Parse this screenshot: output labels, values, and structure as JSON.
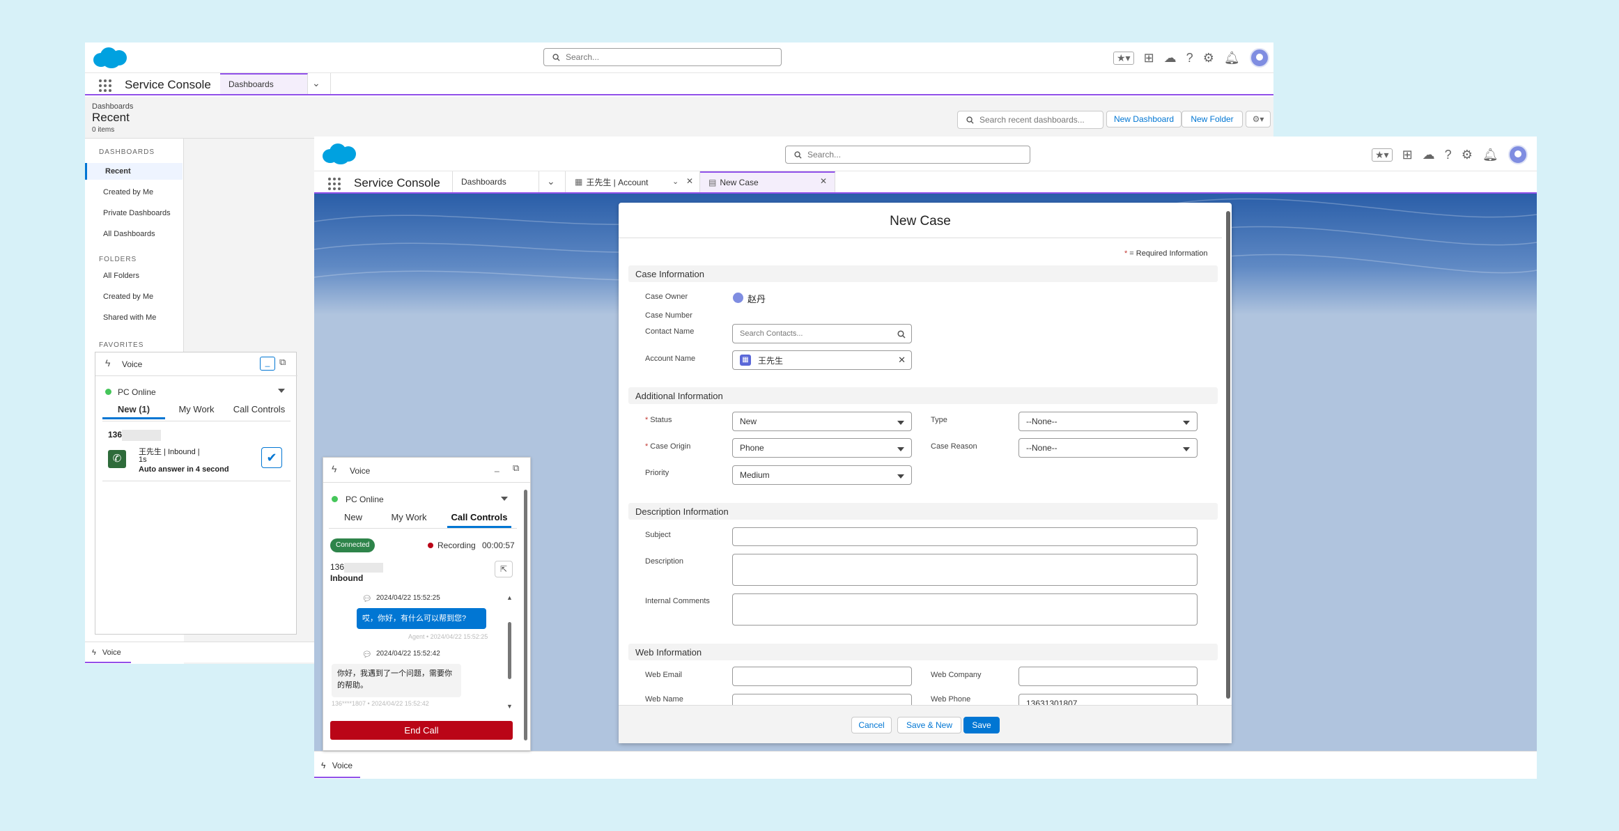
{
  "back": {
    "search_placeholder": "Search...",
    "app_name": "Service Console",
    "tab_dashboards": "Dashboards",
    "breadcrumb": "Dashboards",
    "title": "Recent",
    "count": "0 items",
    "search_dash_placeholder": "Search recent dashboards...",
    "new_dashboard": "New Dashboard",
    "new_folder": "New Folder",
    "sidebar": {
      "dashboards_header": "DASHBOARDS",
      "items": [
        "Recent",
        "Created by Me",
        "Private Dashboards",
        "All Dashboards"
      ],
      "folders_header": "FOLDERS",
      "folder_items": [
        "All Folders",
        "Created by Me",
        "Shared with Me"
      ],
      "favorites_header": "FAVORITES"
    },
    "voice": {
      "title": "Voice",
      "status": "PC Online",
      "tabs": [
        "New (1)",
        "My Work",
        "Call Controls"
      ],
      "number": "136",
      "caller_line": "王先生 | Inbound |",
      "duration": "1s",
      "auto_answer": "Auto answer in 4 second",
      "footer": "Voice"
    }
  },
  "front": {
    "search_placeholder": "Search...",
    "app_name": "Service Console",
    "tabs": [
      "Dashboards",
      "王先生 | Account",
      "New Case"
    ],
    "footer_voice": "Voice"
  },
  "voice": {
    "title": "Voice",
    "status": "PC Online",
    "tabs": [
      "New",
      "My Work",
      "Call Controls"
    ],
    "connected": "Connected",
    "recording": "Recording",
    "timer": "00:00:57",
    "number": "136",
    "direction": "Inbound",
    "messages": [
      {
        "time": "2024/04/22 15:52:25",
        "text": "哎，你好，有什么可以帮到您?",
        "meta": "Agent • 2024/04/22 15:52:25",
        "from": "agent"
      },
      {
        "time": "2024/04/22 15:52:42",
        "text": "你好，我遇到了一个问题，需要你的帮助。",
        "meta": "136****1807 • 2024/04/22 15:52:42",
        "from": "customer"
      }
    ],
    "end_call": "End Call"
  },
  "new_case": {
    "title": "New Case",
    "required_note": "= Required Information",
    "sections": {
      "case_info": "Case Information",
      "additional": "Additional Information",
      "description": "Description Information",
      "web": "Web Information"
    },
    "labels": {
      "case_owner": "Case Owner",
      "case_number": "Case Number",
      "contact_name": "Contact Name",
      "account_name": "Account Name",
      "status": "Status",
      "type": "Type",
      "case_origin": "Case Origin",
      "case_reason": "Case Reason",
      "priority": "Priority",
      "subject": "Subject",
      "description": "Description",
      "internal_comments": "Internal Comments",
      "web_email": "Web Email",
      "web_company": "Web Company",
      "web_name": "Web Name",
      "web_phone": "Web Phone"
    },
    "values": {
      "case_owner": "赵丹",
      "contact_placeholder": "Search Contacts...",
      "account_name": "王先生",
      "status": "New",
      "type": "--None--",
      "case_origin": "Phone",
      "case_reason": "--None--",
      "priority": "Medium",
      "web_phone": "13631301807"
    },
    "buttons": {
      "cancel": "Cancel",
      "save_new": "Save & New",
      "save": "Save"
    }
  },
  "colors": {
    "brand": "#0176d3",
    "accent_purple": "#9050e9",
    "end_call": "#ba0517",
    "connected": "#2e844a",
    "cloud": "#00a1e0"
  }
}
